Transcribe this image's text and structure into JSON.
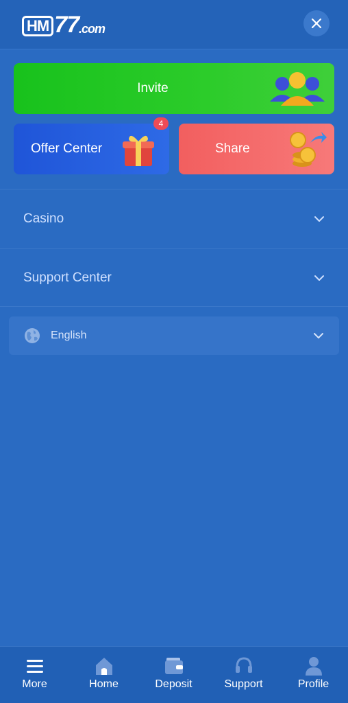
{
  "header": {
    "logo": {
      "part1": "HM",
      "part2": "77",
      "part3": ".com"
    },
    "close_icon": "close-icon"
  },
  "promos": {
    "invite": {
      "label": "Invite",
      "icon": "users-group-icon",
      "color": "#1ec51f"
    },
    "offer": {
      "label": "Offer Center",
      "badge": "4",
      "icon": "gift-icon",
      "color": "#2a62e0"
    },
    "share": {
      "label": "Share",
      "icon": "coins-share-icon",
      "color": "#f36666"
    }
  },
  "menu": {
    "items": [
      {
        "label": "Casino",
        "icon": "chevron-down-icon"
      },
      {
        "label": "Support Center",
        "icon": "chevron-down-icon"
      }
    ]
  },
  "language": {
    "label": "English",
    "icon": "globe-icon"
  },
  "bottom_nav": {
    "items": [
      {
        "label": "More",
        "icon": "menu-icon"
      },
      {
        "label": "Home",
        "icon": "home-icon"
      },
      {
        "label": "Deposit",
        "icon": "wallet-icon"
      },
      {
        "label": "Support",
        "icon": "headset-icon"
      },
      {
        "label": "Profile",
        "icon": "user-icon"
      }
    ]
  },
  "colors": {
    "background": "#2a6bc2",
    "header": "#2463b8",
    "nav": "#2160b5",
    "badge": "#ef4b57"
  }
}
